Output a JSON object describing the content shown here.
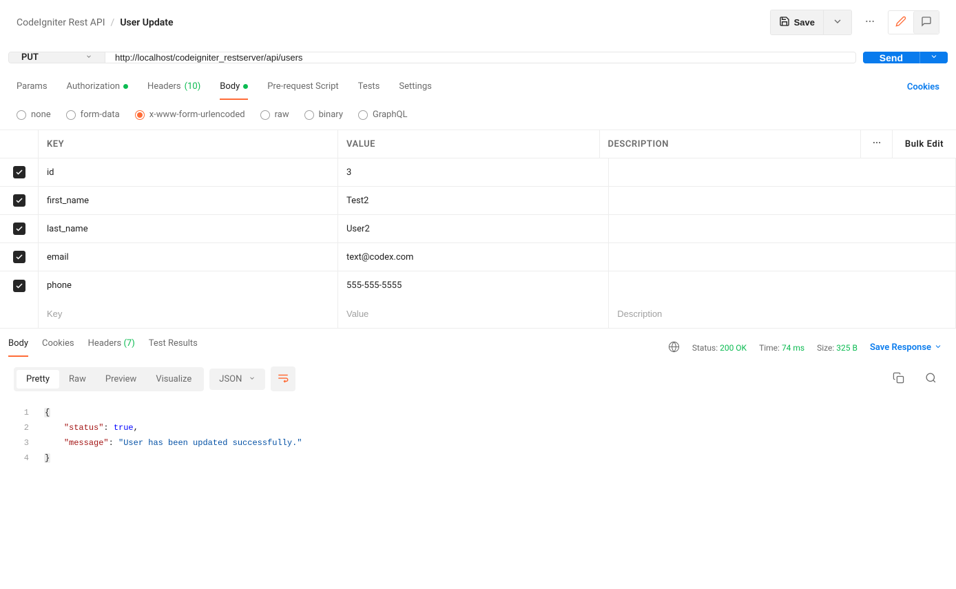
{
  "breadcrumb": {
    "collection": "CodeIgniter Rest API",
    "sep": "/",
    "request": "User Update"
  },
  "header": {
    "save": "Save"
  },
  "request": {
    "method": "PUT",
    "url": "http://localhost/codeigniter_restserver/api/users",
    "send": "Send"
  },
  "tabs": {
    "params": "Params",
    "auth": "Authorization",
    "headers": "Headers",
    "headers_count": "(10)",
    "body": "Body",
    "prereq": "Pre-request Script",
    "tests": "Tests",
    "settings": "Settings",
    "cookies": "Cookies"
  },
  "body_types": {
    "none": "none",
    "formdata": "form-data",
    "urlencoded": "x-www-form-urlencoded",
    "raw": "raw",
    "binary": "binary",
    "graphql": "GraphQL"
  },
  "table": {
    "header": {
      "key": "KEY",
      "value": "VALUE",
      "desc": "DESCRIPTION",
      "bulk": "Bulk Edit"
    },
    "rows": [
      {
        "key": "id",
        "value": "3"
      },
      {
        "key": "first_name",
        "value": "Test2"
      },
      {
        "key": "last_name",
        "value": "User2"
      },
      {
        "key": "email",
        "value": "text@codex.com"
      },
      {
        "key": "phone",
        "value": "555-555-5555"
      }
    ],
    "placeholders": {
      "key": "Key",
      "value": "Value",
      "desc": "Description"
    }
  },
  "response": {
    "tabs": {
      "body": "Body",
      "cookies": "Cookies",
      "headers": "Headers",
      "headers_count": "(7)",
      "tests": "Test Results"
    },
    "meta": {
      "status_lbl": "Status:",
      "status_val": "200 OK",
      "time_lbl": "Time:",
      "time_val": "74 ms",
      "size_lbl": "Size:",
      "size_val": "325 B"
    },
    "save": "Save Response",
    "view_tabs": {
      "pretty": "Pretty",
      "raw": "Raw",
      "preview": "Preview",
      "visualize": "Visualize"
    },
    "format": "JSON",
    "code": {
      "l1": "{",
      "l2_key": "\"status\"",
      "l2_val": "true",
      "l3_key": "\"message\"",
      "l3_val": "\"User has been updated successfully.\"",
      "l4": "}"
    }
  }
}
